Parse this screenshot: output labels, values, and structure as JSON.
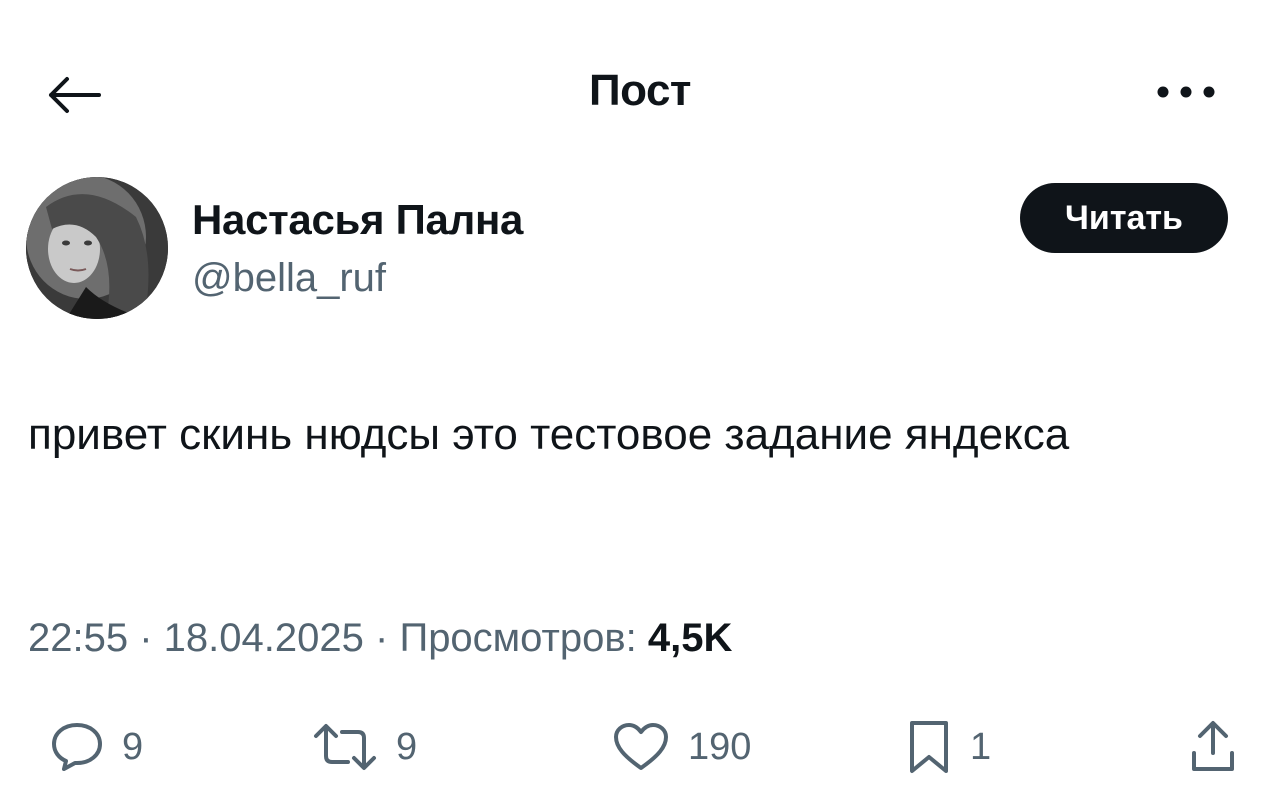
{
  "header": {
    "title": "Пост",
    "back_icon": "arrow-left-icon",
    "more_icon": "more-horizontal-icon"
  },
  "author": {
    "name": "Настасья Пална",
    "handle": "@bella_ruf",
    "follow_label": "Читать"
  },
  "post": {
    "text": "привет скинь нюдсы это тестовое задание яндекса"
  },
  "meta": {
    "time": "22:55",
    "date": "18.04.2025",
    "views_label": "Просмотров:",
    "views_count": "4,5K",
    "separator": "·"
  },
  "actions": {
    "replies": "9",
    "reposts": "9",
    "likes": "190",
    "bookmarks": "1"
  },
  "colors": {
    "text": "#0f1419",
    "secondary": "#536471",
    "button_bg": "#0f1419",
    "background": "#ffffff"
  }
}
